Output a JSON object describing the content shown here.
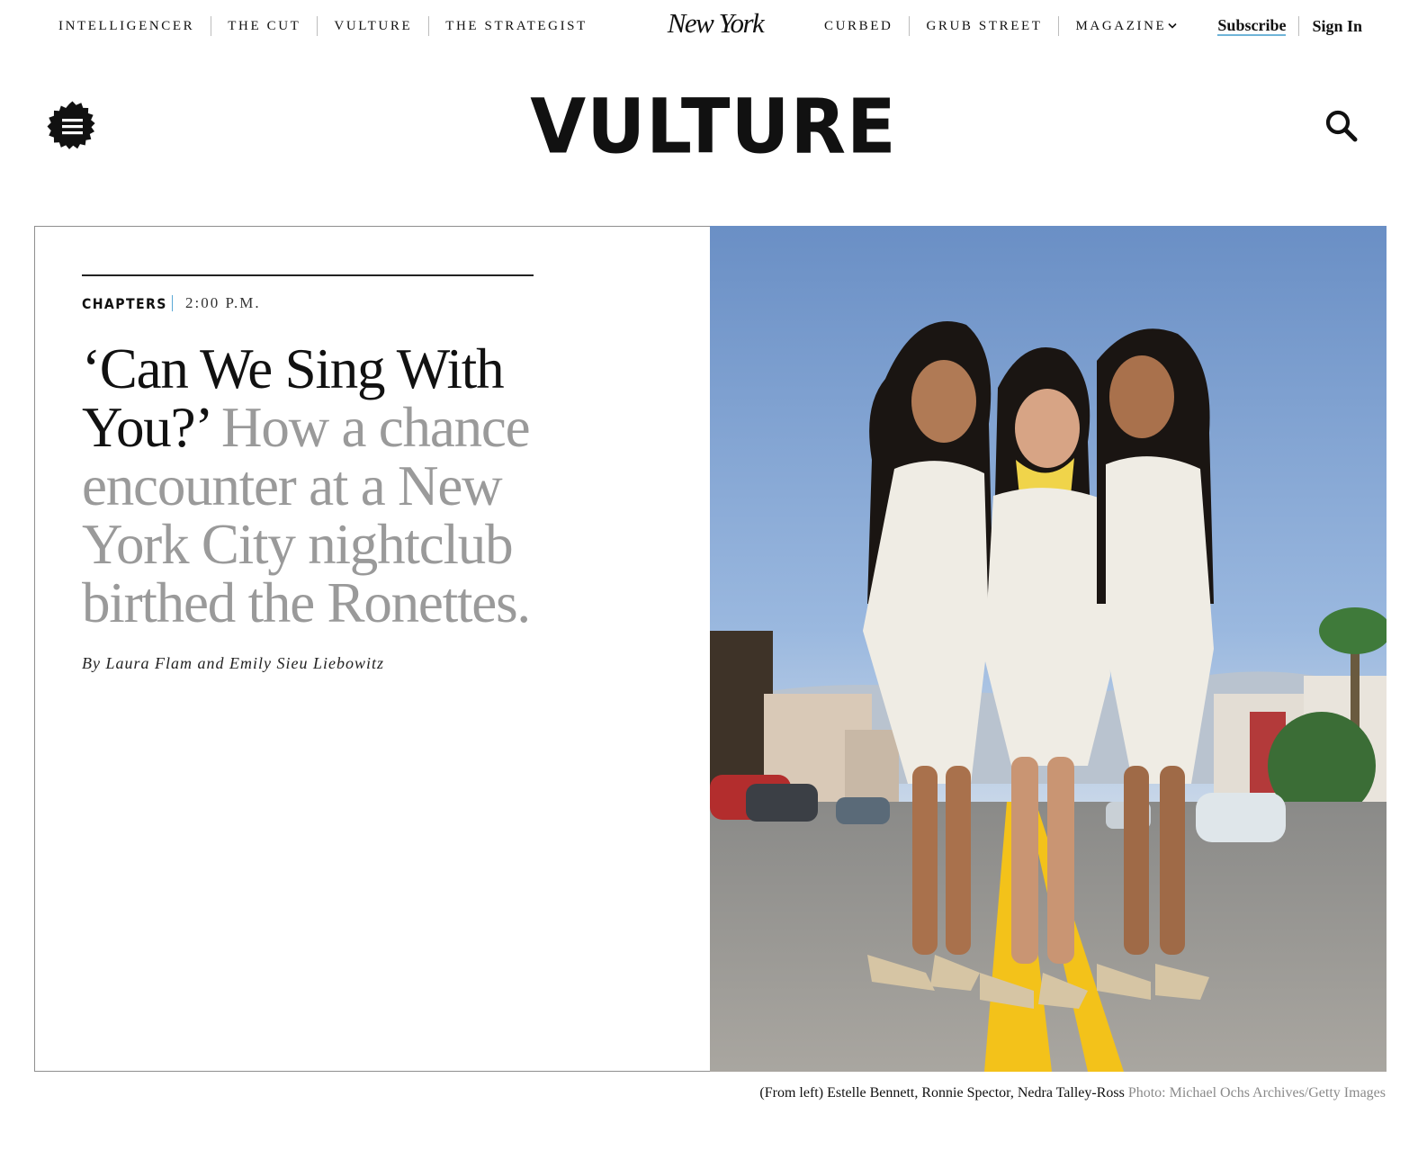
{
  "network_nav": {
    "left": [
      "INTELLIGENCER",
      "THE CUT",
      "VULTURE",
      "THE STRATEGIST"
    ],
    "logo": "New York",
    "right": [
      "CURBED",
      "GRUB STREET",
      "MAGAZINE"
    ]
  },
  "account": {
    "subscribe": "Subscribe",
    "sign_in": "Sign In"
  },
  "brand": {
    "name": "VULTURE"
  },
  "article": {
    "rubric": "CHAPTERS",
    "timestamp": "2:00 P.M.",
    "headline": "‘Can We Sing With You?’",
    "dek": "How a chance encounter at a New York City nightclub birthed the Ronettes.",
    "byline": "By Laura Flam and Emily Sieu Liebowitz",
    "caption": "(From left) Estelle Bennett, Ronnie Spector, Nedra Talley-Ross",
    "credit": "Photo: Michael Ochs Archives/Getty Images"
  },
  "icons": {
    "menu": "hamburger-menu-badge-icon",
    "search": "search-icon",
    "dropdown": "chevron-down-icon"
  },
  "colors": {
    "accent_blue": "#5aa9d6",
    "subscribe_underline": "#6fb4d8",
    "dek_gray": "#9a9a9a"
  }
}
